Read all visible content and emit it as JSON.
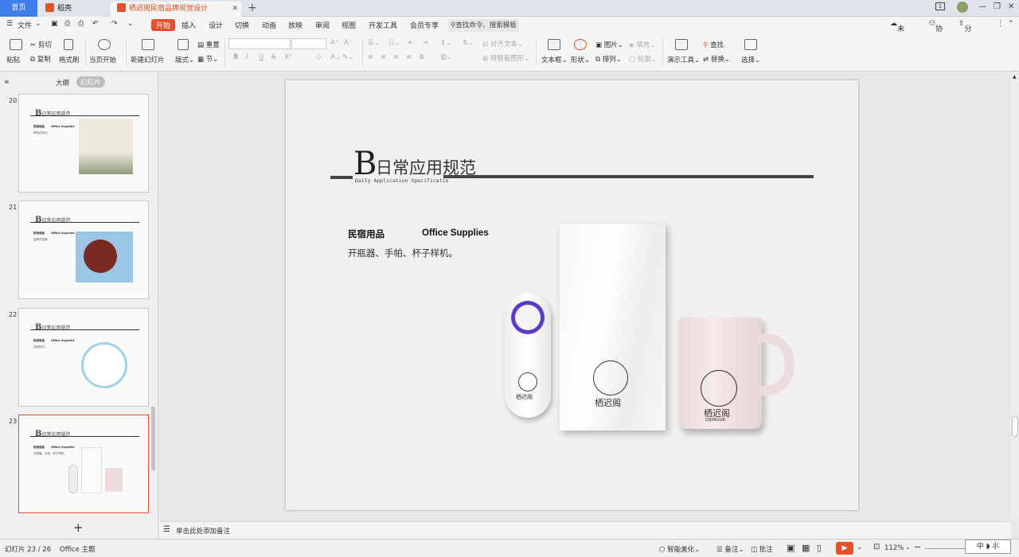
{
  "tabs": {
    "home": "首页",
    "daoke": "稻壳",
    "doc": "栖迟阁民宿品牌视觉设计vis.pptx"
  },
  "menu": {
    "file": "文件",
    "start": "开始",
    "insert": "插入",
    "design": "设计",
    "switch": "切换",
    "animation": "动画",
    "slideshow": "放映",
    "review": "审阅",
    "view": "视图",
    "devtools": "开发工具",
    "member": "会员专享",
    "search": "查找命令、搜索模板",
    "unsync": "未同步",
    "collab": "协作",
    "share": "分享"
  },
  "ribbon": {
    "paste": "粘贴",
    "cut": "剪切",
    "copy": "复制",
    "format_painter": "格式刷",
    "from_current": "当页开始",
    "new_slide": "新建幻灯片",
    "layout": "版式",
    "reset": "重置",
    "section": "节",
    "align_text": "对齐文本",
    "to_smartart": "转智能图形",
    "textbox": "文本框",
    "shape": "形状",
    "image": "图片",
    "arrange": "排列",
    "fill": "填充",
    "outline": "轮廓",
    "present_tools": "演示工具",
    "find": "查找",
    "replace": "替换",
    "select": "选择",
    "font_bold": "B",
    "font_italic": "I",
    "font_underline": "U",
    "font_strike": "S"
  },
  "panel": {
    "outline_tab": "大纲",
    "slides_tab": "幻灯片"
  },
  "thumbs": [
    {
      "num": "20",
      "title": "日常应用规范",
      "h1": "民宿用品",
      "h2": "Office Supplies",
      "sub": "帆布包系列"
    },
    {
      "num": "21",
      "title": "日常应用规范",
      "h1": "民宿用品",
      "h2": "Office Supplies",
      "sub": "招牌外挂牌"
    },
    {
      "num": "22",
      "title": "日常应用规范",
      "h1": "民宿用品",
      "h2": "Office Supplies",
      "sub": "挂钟样式。"
    },
    {
      "num": "23",
      "title": "日常应用规范",
      "h1": "民宿用品",
      "h2": "Office Supplies",
      "sub": "开瓶器、手帕、杯子样机。"
    }
  ],
  "slide": {
    "big_letter": "B",
    "title": "日常应用规范",
    "subtitle_en": "Daily Application Specificatio",
    "heading_cn": "民宿用品",
    "heading_en": "Office Supplies",
    "body": "开瓶器、手帕、杯子样机。",
    "logo_text": "栖迟阁",
    "logo_en": "QIJINGGE"
  },
  "notes": {
    "placeholder": "单击此处添加备注"
  },
  "status": {
    "slide_count": "幻灯片 23 / 26",
    "theme": "Office 主题",
    "beautify": "智能美化",
    "notes_btn": "备注",
    "comment": "批注",
    "zoom": "112%",
    "ime": "中 ◗ ⺢"
  },
  "colors": {
    "accent": "#e5502c",
    "home_tab": "#3d7ee9"
  }
}
